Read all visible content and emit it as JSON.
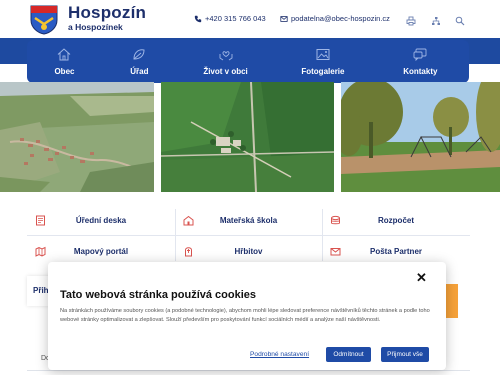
{
  "header": {
    "title": "Hospozín",
    "subtitle": "a Hospozínek",
    "phone": "+420 315 766 043",
    "email": "podatelna@obec-hospozin.cz",
    "icons": [
      "print-icon",
      "sitemap-icon",
      "search-icon"
    ]
  },
  "colors": {
    "brand": "#1f4ba6",
    "accent": "#f6a23a",
    "text": "#1d2f6b"
  },
  "nav": [
    {
      "label": "Obec",
      "icon": "home-icon"
    },
    {
      "label": "Úřad",
      "icon": "leaf-icon"
    },
    {
      "label": "Život v obci",
      "icon": "heart-hands-icon"
    },
    {
      "label": "Fotogalerie",
      "icon": "image-icon"
    },
    {
      "label": "Kontakty",
      "icon": "chat-icon"
    }
  ],
  "quick_links": [
    {
      "label": "Úřední deska",
      "icon": "notice-board-icon"
    },
    {
      "label": "Mateřská škola",
      "icon": "school-icon"
    },
    {
      "label": "Rozpočet",
      "icon": "coins-icon"
    },
    {
      "label": "Mapový portál",
      "icon": "map-icon"
    },
    {
      "label": "Hřbitov",
      "icon": "grave-icon"
    },
    {
      "label": "Pošta Partner",
      "icon": "mail-icon"
    }
  ],
  "background": {
    "card_label": "Přihl",
    "text_fragment": "Do"
  },
  "cookie": {
    "close": "✕",
    "title": "Tato webová stránka používá cookies",
    "text": "Na stránkách používáme soubory cookies (a podobné technologie), abychom mohli lépe sledovat preference návštěvníků těchto stránek a podle toho webové stránky optimalizovat a zlepšovat. Slouží především pro poskytování funkcí sociálních médií a analýze naší návštěvnosti.",
    "settings_link": "Podrobné nastavení",
    "accept_button": "Odmítnout",
    "accept_all_button": "Přijmout vše"
  }
}
